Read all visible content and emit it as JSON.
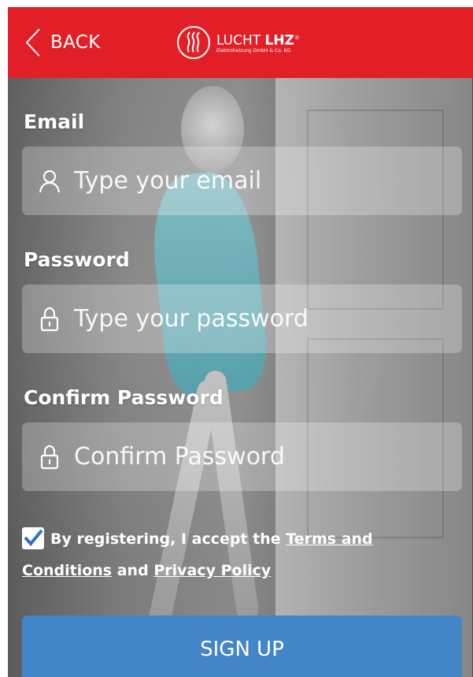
{
  "header": {
    "back_label": "BACK",
    "logo": {
      "name_light": "LUCHT",
      "name_bold": "LHZ",
      "registered": "®",
      "tagline": "Elektroheizung GmbH & Co. KG"
    }
  },
  "form": {
    "email": {
      "label": "Email",
      "placeholder": "Type your email",
      "icon": "user-icon"
    },
    "password": {
      "label": "Password",
      "placeholder": "Type your password",
      "icon": "lock-icon"
    },
    "confirm_password": {
      "label": "Confirm Password",
      "placeholder": "Confirm Password",
      "icon": "lock-icon"
    }
  },
  "terms": {
    "checked": true,
    "prefix": "By registering, I accept the ",
    "terms_link": "Terms and Conditions",
    "conjunction": " and ",
    "privacy_link": "Privacy Policy"
  },
  "actions": {
    "signup_label": "SIGN UP"
  },
  "colors": {
    "header": "#e21f26",
    "button": "#4386c7",
    "checkmark": "#2d74c2"
  }
}
